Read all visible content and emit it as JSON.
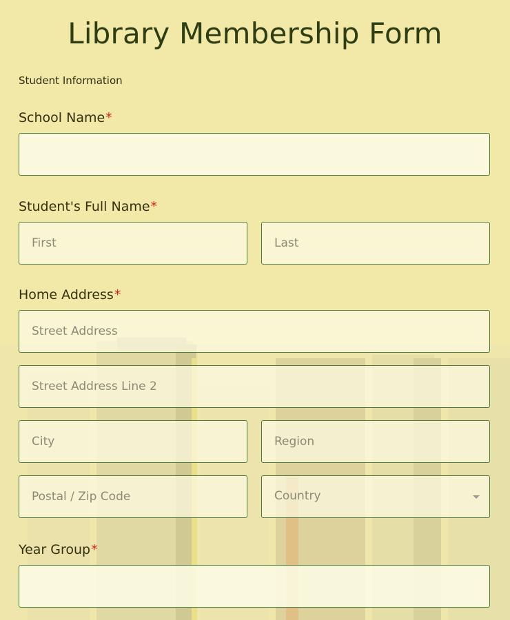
{
  "form": {
    "title": "Library Membership Form",
    "section_label": "Student Information",
    "required_marker": "*",
    "colors": {
      "background": "#f2e9a8",
      "border": "#4c7a38",
      "required": "#c8261b",
      "title": "#2f3d14"
    }
  },
  "fields": {
    "school_name": {
      "label": "School Name",
      "value": ""
    },
    "student_name": {
      "label": "Student's Full Name",
      "first_placeholder": "First",
      "last_placeholder": "Last"
    },
    "home_address": {
      "label": "Home Address",
      "street_placeholder": "Street Address",
      "street2_placeholder": "Street Address Line 2",
      "city_placeholder": "City",
      "region_placeholder": "Region",
      "postal_placeholder": "Postal / Zip Code",
      "country_placeholder": "Country",
      "country_icon": "chevron-down-icon"
    },
    "year_group": {
      "label": "Year Group",
      "value": ""
    }
  }
}
